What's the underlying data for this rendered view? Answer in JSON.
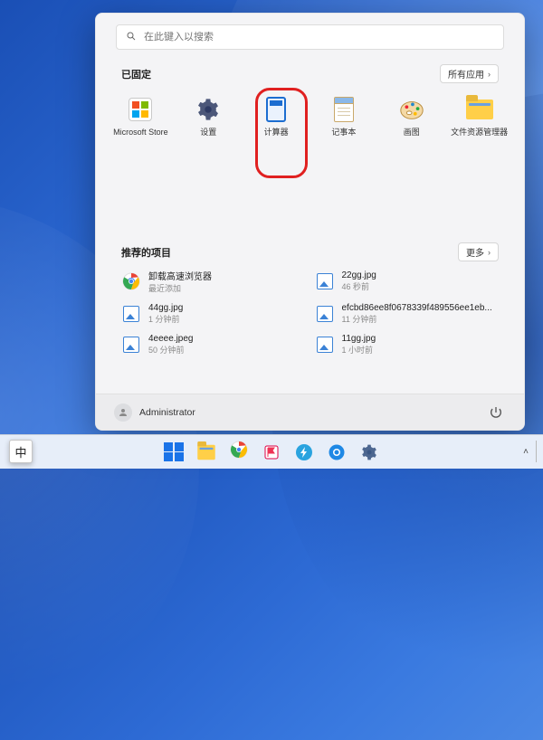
{
  "search": {
    "placeholder": "在此键入以搜索"
  },
  "pinned": {
    "title": "已固定",
    "all_apps_label": "所有应用",
    "items": [
      {
        "label": "Microsoft Store"
      },
      {
        "label": "设置"
      },
      {
        "label": "计算器"
      },
      {
        "label": "记事本"
      },
      {
        "label": "画图"
      },
      {
        "label": "文件资源管理器"
      }
    ]
  },
  "recommended": {
    "title": "推荐的项目",
    "more_label": "更多",
    "items": [
      {
        "title": "卸载高速浏览器",
        "sub": "最近添加"
      },
      {
        "title": "22gg.jpg",
        "sub": "46 秒前"
      },
      {
        "title": "44gg.jpg",
        "sub": "1 分钟前"
      },
      {
        "title": "efcbd86ee8f0678339f489556ee1eb...",
        "sub": "11 分钟前"
      },
      {
        "title": "4eeee.jpeg",
        "sub": "50 分钟前"
      },
      {
        "title": "11gg.jpg",
        "sub": "1 小时前"
      }
    ]
  },
  "user": {
    "name": "Administrator"
  },
  "ime": {
    "label": "中"
  }
}
